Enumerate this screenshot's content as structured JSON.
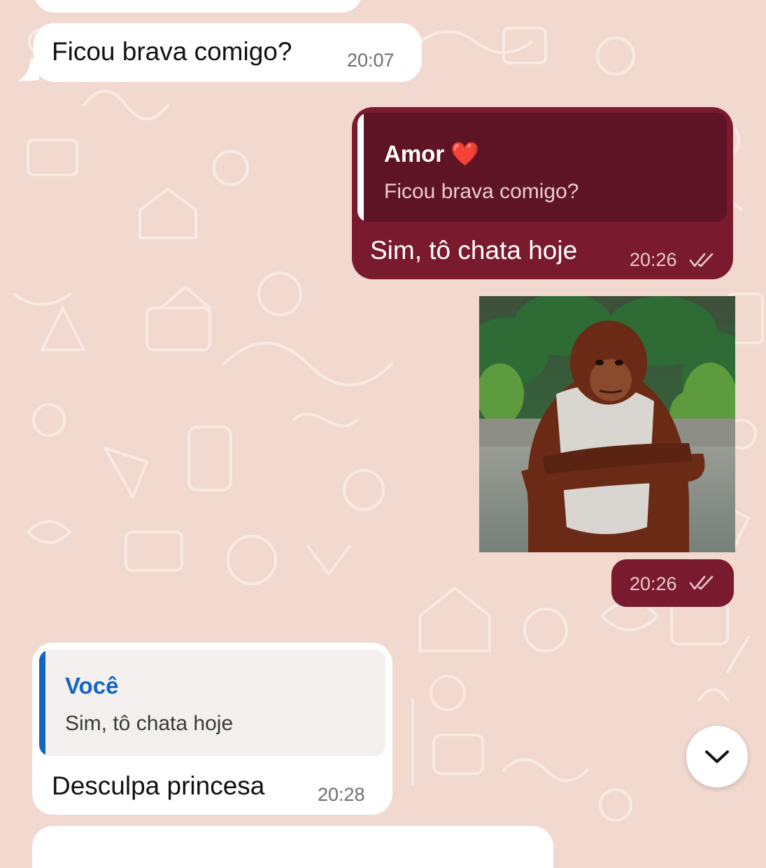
{
  "colors": {
    "wallpaper": "#f2d9d0",
    "incoming_bubble": "#ffffff",
    "outgoing_bubble": "#7a1a2e",
    "outgoing_quote_bg": "#5e1424",
    "incoming_quote_bg": "#f4f0f0",
    "incoming_quote_accent": "#1565c0"
  },
  "messages": [
    {
      "text": "Ficou brava comigo?",
      "time": "20:07"
    },
    {
      "quote_name": "Amor ❤️",
      "quote_text": "Ficou brava comigo?",
      "text": "Sim, tô chata hoje",
      "time": "20:26"
    },
    {
      "time": "20:26"
    },
    {
      "quote_name": "Você",
      "quote_text": "Sim, tô chata hoje",
      "text": "Desculpa princesa",
      "time": "20:28"
    }
  ],
  "icons": {
    "read_receipt": "double-check-icon",
    "scroll_down": "chevron-down-icon"
  }
}
